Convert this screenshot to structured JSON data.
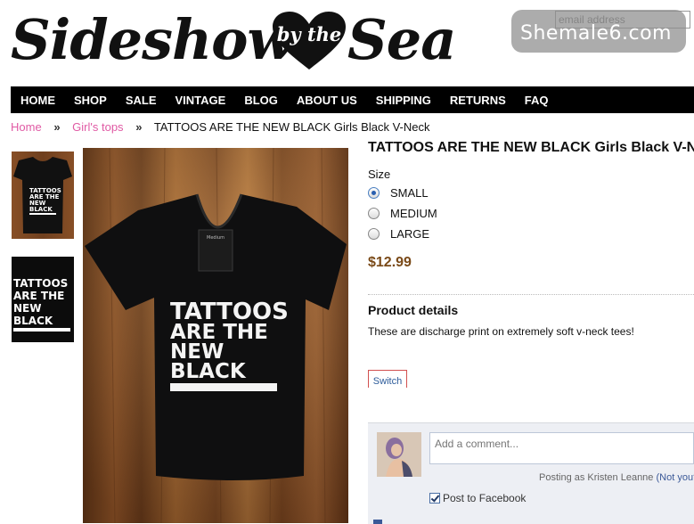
{
  "header": {
    "logo_left": "Sideshow",
    "logo_heart_text": "by the",
    "logo_right": "Sea",
    "email_placeholder": "email address",
    "watermark": "Shemale6.com"
  },
  "nav": {
    "items": [
      "HOME",
      "SHOP",
      "SALE",
      "VINTAGE",
      "BLOG",
      "ABOUT US",
      "SHIPPING",
      "RETURNS",
      "FAQ"
    ]
  },
  "breadcrumb": {
    "home": "Home",
    "category": "Girl's tops",
    "separator": "»",
    "current": "TATTOOS ARE THE NEW BLACK Girls Black V-Neck"
  },
  "product": {
    "title": "TATTOOS ARE THE NEW BLACK Girls Black V-Neck",
    "size_label": "Size",
    "sizes": [
      "SMALL",
      "MEDIUM",
      "LARGE"
    ],
    "selected_size": "SMALL",
    "price": "$12.99",
    "details_title": "Product details",
    "details_text": "These are discharge print on extremely soft v-neck tees!",
    "switch_label": "Switch",
    "shirt_print": [
      "TATTOOS",
      "ARE THE",
      "NEW",
      "BLACK"
    ],
    "shirt_tag": "Medium"
  },
  "comments": {
    "placeholder": "Add a comment...",
    "posting_as": "Posting as Kristen Leanne",
    "not_you": "(Not you?)",
    "post_to_facebook": "Post to Facebook"
  },
  "colors": {
    "nav_bg": "#000000",
    "breadcrumb_link": "#e05aa4",
    "price": "#7a4a18",
    "comment_bg": "#edeff4",
    "facebook_blue": "#3b5998"
  }
}
